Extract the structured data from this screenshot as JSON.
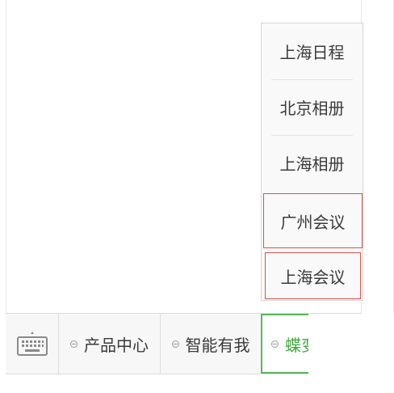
{
  "popup_menu": {
    "items": [
      {
        "label": "上海日程"
      },
      {
        "label": "北京相册"
      },
      {
        "label": "上海相册"
      },
      {
        "label": "广州会议"
      },
      {
        "label": "上海会议"
      }
    ]
  },
  "menu_bar": {
    "keyboard_icon": "keyboard-icon",
    "items": [
      {
        "label": "产品中心"
      },
      {
        "label": "智能有我"
      },
      {
        "label": "蝶变"
      }
    ]
  },
  "colors": {
    "active_accent": "#3aa83a",
    "highlight_border": "#d9534f"
  }
}
